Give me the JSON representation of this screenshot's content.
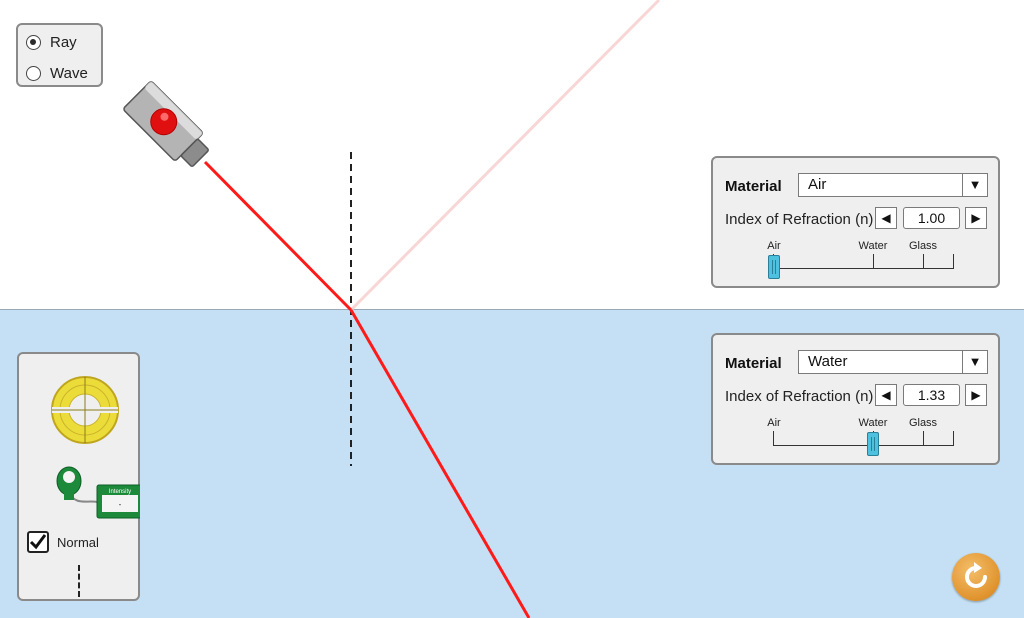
{
  "view_mode": {
    "options": [
      {
        "label": "Ray",
        "selected": true
      },
      {
        "label": "Wave",
        "selected": false
      }
    ]
  },
  "top_material": {
    "title": "Material",
    "selected": "Air",
    "ior_label": "Index of Refraction (n)",
    "ior_value": "1.00",
    "slider_ticks": [
      "Air",
      "Water",
      "Glass"
    ],
    "slider_level": 1.0
  },
  "bottom_material": {
    "title": "Material",
    "selected": "Water",
    "ior_label": "Index of Refraction (n)",
    "ior_value": "1.33",
    "slider_ticks": [
      "Air",
      "Water",
      "Glass"
    ],
    "slider_level": 1.33
  },
  "toolbox": {
    "normal_label": "Normal",
    "normal_checked": true,
    "intensity_meter_label": "Intensity",
    "intensity_meter_value": "-"
  },
  "colors": {
    "laser": "#ff1a1a",
    "reflected_beam": "#f8d6d6",
    "bottom_medium": "#c5e0f4",
    "top_medium": "#ffffff",
    "panel_bg": "#efefef",
    "slider_thumb": "#4ec0e0",
    "reset_button": "#e0932d"
  },
  "icons": {
    "laser": "laser-pointer-icon",
    "protractor": "protractor-icon",
    "intensity_meter": "intensity-meter-icon",
    "reset": "reset-icon",
    "dropdown": "triangle-down-icon",
    "decrement": "triangle-left-icon",
    "increment": "triangle-right-icon"
  }
}
